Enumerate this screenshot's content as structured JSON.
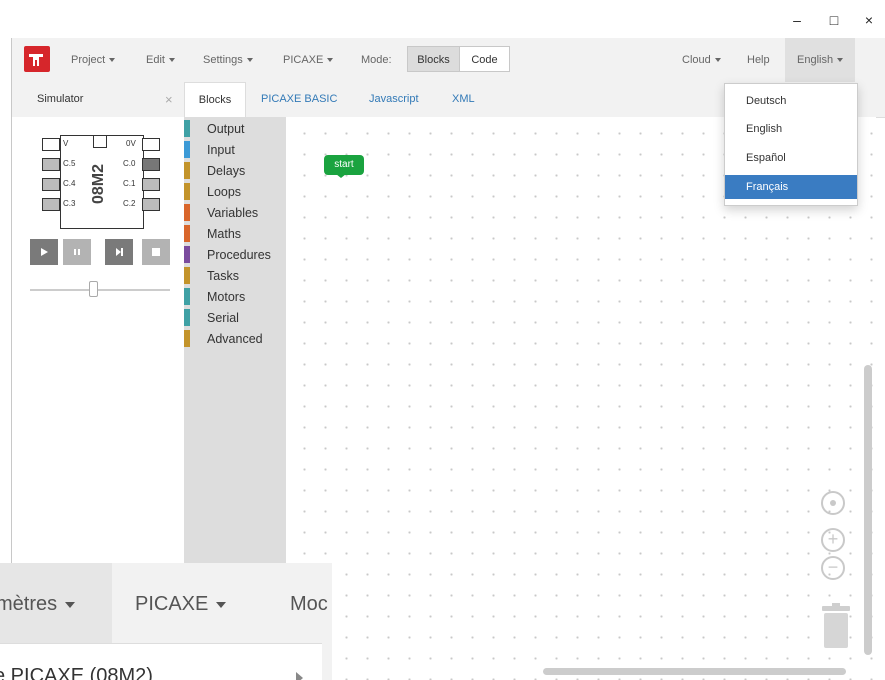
{
  "window": {
    "controls": [
      "–",
      "□",
      "×"
    ]
  },
  "navbar": {
    "menus": [
      "Project",
      "Edit",
      "Settings",
      "PICAXE"
    ],
    "mode_label": "Mode:",
    "mode_blocks": "Blocks",
    "mode_code": "Code",
    "cloud": "Cloud",
    "help": "Help",
    "language": "English"
  },
  "tabs": {
    "simulator": "Simulator",
    "close": "×",
    "items": [
      "Blocks",
      "PICAXE BASIC",
      "Javascript",
      "XML"
    ]
  },
  "chip": {
    "name": "08M2",
    "left_pins": [
      "V",
      "C.5",
      "C.4",
      "C.3"
    ],
    "right_pins": [
      "0V",
      "C.0",
      "C.1",
      "C.2"
    ]
  },
  "toolbox": {
    "categories": [
      {
        "label": "Output",
        "color": "#3fa1a5"
      },
      {
        "label": "Input",
        "color": "#3c9ad6"
      },
      {
        "label": "Delays",
        "color": "#c3942b"
      },
      {
        "label": "Loops",
        "color": "#c3942b"
      },
      {
        "label": "Variables",
        "color": "#d9662b"
      },
      {
        "label": "Maths",
        "color": "#d9662b"
      },
      {
        "label": "Procedures",
        "color": "#7b4c9e"
      },
      {
        "label": "Tasks",
        "color": "#c3942b"
      },
      {
        "label": "Motors",
        "color": "#3fa1a5"
      },
      {
        "label": "Serial",
        "color": "#3fa1a5"
      },
      {
        "label": "Advanced",
        "color": "#c3942b"
      }
    ]
  },
  "workspace": {
    "start_block": "start"
  },
  "language_menu": {
    "items": [
      "Deutsch",
      "English",
      "Español",
      "Français"
    ],
    "selected": "Français"
  },
  "zoom_overlay": {
    "menu1": "mètres",
    "menu2": "PICAXE",
    "menu3": "Moc",
    "submenu": "e PICAXE (08M2)"
  },
  "colors": {
    "accent": "#337ab7",
    "selected": "#3a7cc2",
    "brand": "#d6262b"
  }
}
